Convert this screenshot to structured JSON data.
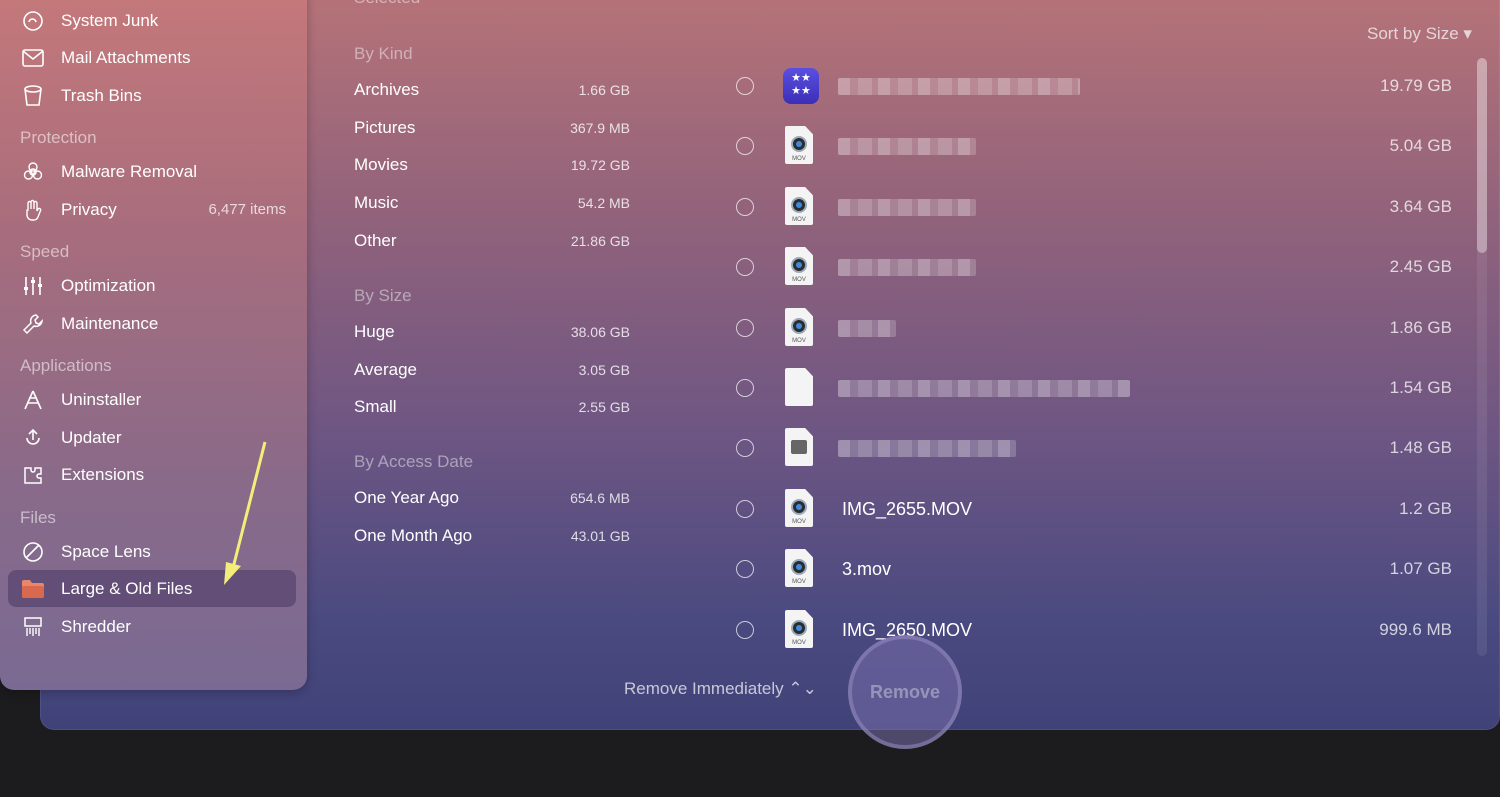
{
  "sidebar": {
    "items_top": [
      {
        "label": "System Junk",
        "icon": "system-junk-icon"
      },
      {
        "label": "Mail Attachments",
        "icon": "mail-icon"
      },
      {
        "label": "Trash Bins",
        "icon": "trash-icon"
      }
    ],
    "protection": {
      "title": "Protection",
      "items": [
        {
          "label": "Malware Removal",
          "icon": "biohazard-icon"
        },
        {
          "label": "Privacy",
          "icon": "hand-icon",
          "count": "6,477 items"
        }
      ]
    },
    "speed": {
      "title": "Speed",
      "items": [
        {
          "label": "Optimization",
          "icon": "sliders-icon"
        },
        {
          "label": "Maintenance",
          "icon": "wrench-icon"
        }
      ]
    },
    "applications": {
      "title": "Applications",
      "items": [
        {
          "label": "Uninstaller",
          "icon": "uninstaller-icon"
        },
        {
          "label": "Updater",
          "icon": "updater-icon"
        },
        {
          "label": "Extensions",
          "icon": "extensions-icon"
        }
      ]
    },
    "files": {
      "title": "Files",
      "items": [
        {
          "label": "Space Lens",
          "icon": "space-lens-icon"
        },
        {
          "label": "Large & Old Files",
          "icon": "folder-icon",
          "active": true
        },
        {
          "label": "Shredder",
          "icon": "shredder-icon"
        }
      ]
    }
  },
  "categories": {
    "selected_label": "Selected",
    "by_kind": {
      "title": "By Kind",
      "rows": [
        {
          "name": "Archives",
          "size": "1.66 GB"
        },
        {
          "name": "Pictures",
          "size": "367.9 MB"
        },
        {
          "name": "Movies",
          "size": "19.72 GB"
        },
        {
          "name": "Music",
          "size": "54.2 MB"
        },
        {
          "name": "Other",
          "size": "21.86 GB"
        }
      ]
    },
    "by_size": {
      "title": "By Size",
      "rows": [
        {
          "name": "Huge",
          "size": "38.06 GB"
        },
        {
          "name": "Average",
          "size": "3.05 GB"
        },
        {
          "name": "Small",
          "size": "2.55 GB"
        }
      ]
    },
    "by_access": {
      "title": "By Access Date",
      "rows": [
        {
          "name": "One Year Ago",
          "size": "654.6 MB"
        },
        {
          "name": "One Month Ago",
          "size": "43.01 GB"
        }
      ]
    }
  },
  "file_list": {
    "sort_label": "Sort by Size ▾",
    "files": [
      {
        "name": "",
        "size": "19.79 GB",
        "type": "app"
      },
      {
        "name": "",
        "size": "5.04 GB",
        "type": "mov"
      },
      {
        "name": "",
        "size": "3.64 GB",
        "type": "mov"
      },
      {
        "name": "",
        "size": "2.45 GB",
        "type": "mov"
      },
      {
        "name": "",
        "size": "1.86 GB",
        "type": "mov"
      },
      {
        "name": "",
        "size": "1.54 GB",
        "type": "doc"
      },
      {
        "name": "",
        "size": "1.48 GB",
        "type": "drive"
      },
      {
        "name": "IMG_2655.MOV",
        "size": "1.2 GB",
        "type": "mov"
      },
      {
        "name": "3.mov",
        "size": "1.07 GB",
        "type": "mov"
      },
      {
        "name": "IMG_2650.MOV",
        "size": "999.6 MB",
        "type": "mov"
      }
    ],
    "mov_badge": "MOV",
    "app_glyph": "★★ ★★"
  },
  "footer": {
    "remove_mode": "Remove Immediately ⌃⌄",
    "remove_button": "Remove"
  },
  "colors": {
    "accent_arrow": "#f3ee7a",
    "folder": "#e8866a"
  }
}
